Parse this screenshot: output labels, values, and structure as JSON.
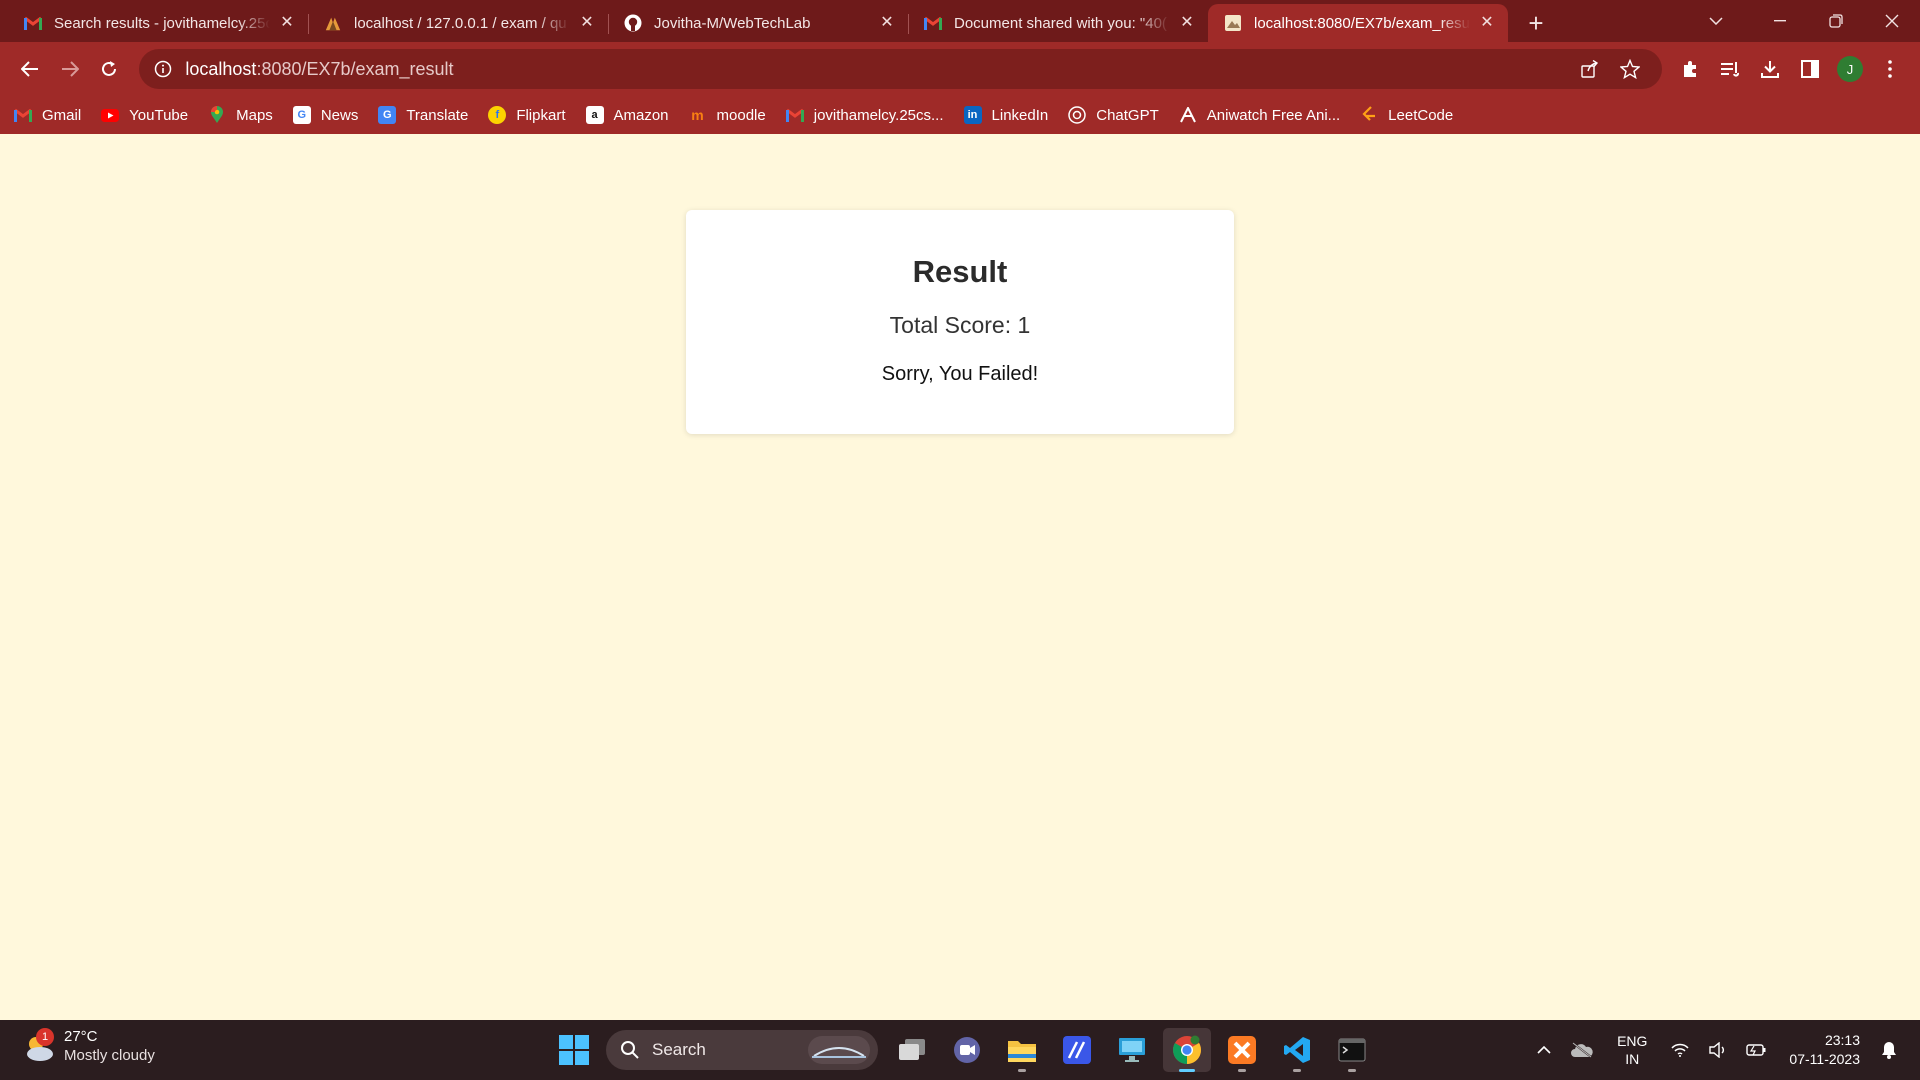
{
  "browser": {
    "tabs": [
      {
        "title": "Search results - jovithamelcy.25c",
        "icon": "gmail-icon",
        "active": false
      },
      {
        "title": "localhost / 127.0.0.1 / exam / qu",
        "icon": "phpmyadmin-icon",
        "active": false
      },
      {
        "title": "Jovitha-M/WebTechLab",
        "icon": "github-icon",
        "active": false
      },
      {
        "title": "Document shared with you: \"40(",
        "icon": "gmail-icon",
        "active": false
      },
      {
        "title": "localhost:8080/EX7b/exam_resul",
        "icon": "page-icon",
        "active": true
      }
    ],
    "new_tab": "+",
    "address": {
      "host": "localhost",
      "path": ":8080/EX7b/exam_result"
    },
    "profile_initial": "J",
    "bookmarks": [
      {
        "label": "Gmail",
        "icon": "gmail-icon"
      },
      {
        "label": "YouTube",
        "icon": "youtube-icon"
      },
      {
        "label": "Maps",
        "icon": "maps-icon"
      },
      {
        "label": "News",
        "icon": "news-icon"
      },
      {
        "label": "Translate",
        "icon": "translate-icon"
      },
      {
        "label": "Flipkart",
        "icon": "flipkart-icon"
      },
      {
        "label": "Amazon",
        "icon": "amazon-icon"
      },
      {
        "label": "moodle",
        "icon": "moodle-icon"
      },
      {
        "label": "jovithamelcy.25cs...",
        "icon": "gmail-icon"
      },
      {
        "label": "LinkedIn",
        "icon": "linkedin-icon"
      },
      {
        "label": "ChatGPT",
        "icon": "chatgpt-icon"
      },
      {
        "label": "Aniwatch Free Ani...",
        "icon": "aniwatch-icon"
      },
      {
        "label": "LeetCode",
        "icon": "leetcode-icon"
      }
    ]
  },
  "page": {
    "heading": "Result",
    "score_text": "Total Score: 1",
    "message": "Sorry, You Failed!",
    "background_color": "#fff8dc"
  },
  "taskbar": {
    "weather": {
      "temp": "27°C",
      "condition": "Mostly cloudy",
      "badge": "1"
    },
    "search_placeholder": "Search",
    "apps": [
      "file-explorer-task-view",
      "teams-icon",
      "file-explorer-icon",
      "editor-icon",
      "remote-desktop-icon",
      "chrome-icon",
      "xampp-icon",
      "vscode-icon",
      "terminal-icon"
    ],
    "lang": {
      "line1": "ENG",
      "line2": "IN"
    },
    "clock": {
      "time": "23:13",
      "date": "07-11-2023"
    }
  },
  "colors": {
    "tab_bar": "#6e1a1a",
    "toolbar": "#9f2a28",
    "taskbar": "#2b1d1f",
    "accent": "#60cdff"
  }
}
